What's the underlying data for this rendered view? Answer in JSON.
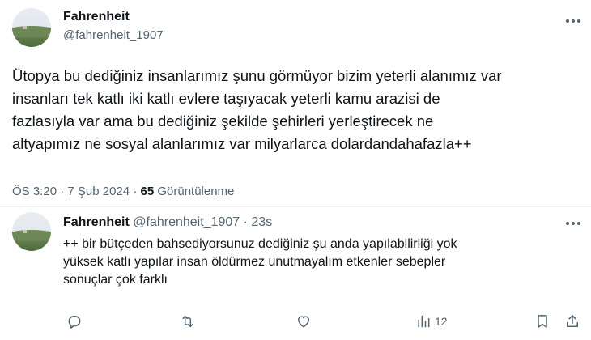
{
  "main_tweet": {
    "author_name": "Fahrenheit",
    "author_handle": "@fahrenheit_1907",
    "text": "Ütopya bu dediğiniz insanlarımız şunu görmüyor bizim yeterli alanımız var\ninsanları tek katlı iki katlı evlere taşıyacak yeterli kamu arazisi de\nfazlasıyla var ama bu dediğiniz şekilde şehirleri yerleştirecek ne\naltyapımız ne sosyal alanlarımız var milyarlarca dolardandahafazla++",
    "time": "ÖS 3:20",
    "date": "7 Şub 2024",
    "separator": "·",
    "views_count": "65",
    "views_label": "Görüntülenme"
  },
  "reply": {
    "author_name": "Fahrenheit",
    "author_handle": "@fahrenheit_1907",
    "separator": "·",
    "age": "23s",
    "text": "++ bir bütçeden bahsediyorsunuz dediğiniz şu anda yapılabilirliği yok\nyüksek katlı yapılar insan öldürmez unutmayalım etkenler sebepler\nsonuçlar çok farklı",
    "views_count": "12"
  },
  "icons": {
    "reply": "reply-icon",
    "retweet": "retweet-icon",
    "like": "heart-icon",
    "views": "bar-chart-icon",
    "bookmark": "bookmark-icon",
    "share": "share-icon",
    "more": "more-icon"
  },
  "colors": {
    "text_primary": "#0f1419",
    "text_secondary": "#536471",
    "divider": "#eff3f4"
  }
}
